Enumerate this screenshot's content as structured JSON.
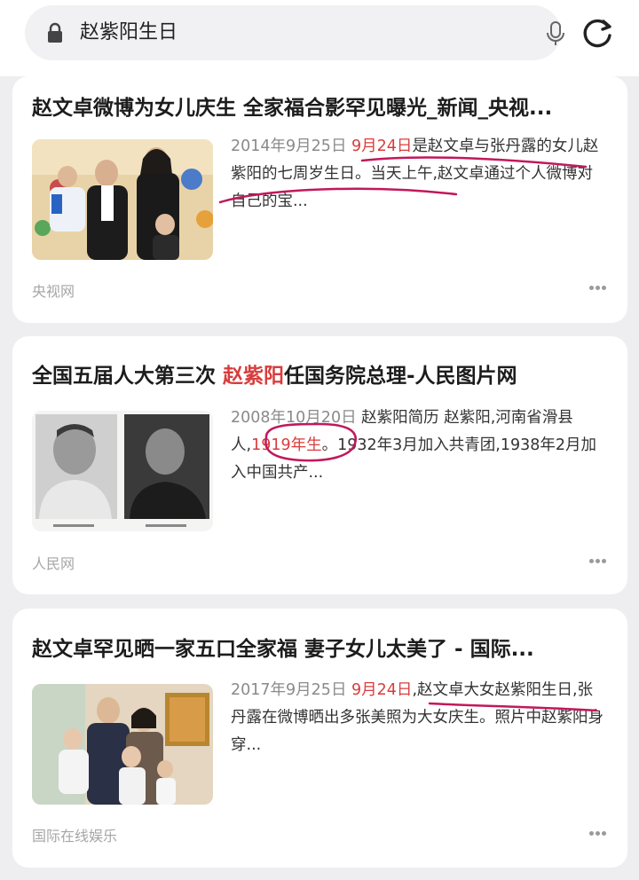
{
  "search": {
    "query": "赵紫阳生日",
    "lock_icon": "lock-icon",
    "mic_icon": "microphone-icon",
    "refresh_icon": "refresh-icon"
  },
  "results": [
    {
      "title": "赵文卓微博为女儿庆生 全家福合影罕见曝光_新闻_央视...",
      "date": "2014年9月25日",
      "snippet_hl": "9月24日",
      "snippet_rest": "是赵文卓与张丹露的女儿赵紫阳的七周岁生日。当天上午,赵文卓通过个人微博对自己的宝...",
      "source": "央视网"
    },
    {
      "title_pre": "全国五届人大第三次 ",
      "title_hl": "赵紫阳",
      "title_post": "任国务院总理-人民图片网",
      "date": "2008年10月20日",
      "snippet_a": " 赵紫阳简历 赵紫阳,河南省滑县人,",
      "snippet_hl": "1919年生",
      "snippet_b": "。1932年3月加入共青团,1938年2月加入中国共产...",
      "source": "人民网"
    },
    {
      "title": "赵文卓罕见晒一家五口全家福 妻子女儿太美了 - 国际...",
      "date": "2017年9月25日",
      "snippet_hl": "9月24日",
      "snippet_rest": ",赵文卓大女赵紫阳生日,张丹露在微博晒出多张美照为大女庆生。照片中赵紫阳身穿...",
      "source": "国际在线娱乐"
    }
  ],
  "colors": {
    "highlight": "#d93c3c",
    "annotation": "#c2185b"
  }
}
